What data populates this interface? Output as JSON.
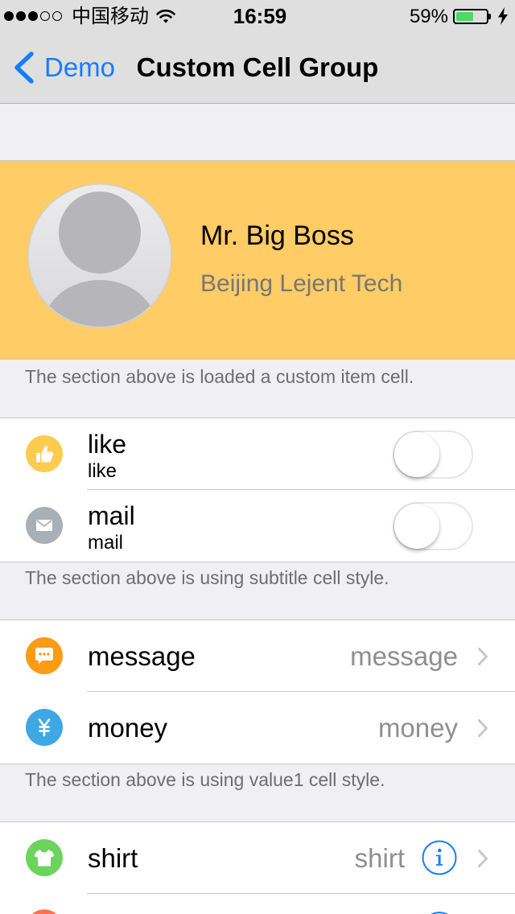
{
  "status_bar": {
    "signal_level": 3,
    "signal_max": 5,
    "carrier": "中国移动",
    "wifi_icon": "wifi-icon",
    "time": "16:59",
    "battery_text": "59%",
    "battery_level": 0.59,
    "battery_color": "#4cd964",
    "charging": true
  },
  "nav": {
    "back_icon": "chevron-left-icon",
    "back_label": "Demo",
    "title": "Custom Cell Group",
    "tint": "#157efb"
  },
  "profile": {
    "avatar_icon": "default-avatar-icon",
    "name": "Mr. Big Boss",
    "company": "Beijing Lejent Tech",
    "background": "#ffcc66"
  },
  "sections": [
    {
      "footer": "The section above is loaded a custom item cell."
    },
    {
      "rows": [
        {
          "icon": "thumbs-up-icon",
          "icon_color": "#fdcb4e",
          "title": "like",
          "subtitle": "like",
          "switch_on": false
        },
        {
          "icon": "mail-icon",
          "icon_color": "#a9afb6",
          "title": "mail",
          "subtitle": "mail",
          "switch_on": false
        }
      ],
      "footer": "The section above is using subtitle cell style."
    },
    {
      "rows": [
        {
          "icon": "message-icon",
          "icon_color": "#fb9c14",
          "title": "message",
          "detail": "message",
          "accessory": "chevron-right-icon"
        },
        {
          "icon": "yen-icon",
          "icon_color": "#3ea8e5",
          "title": "money",
          "detail": "money",
          "accessory": "chevron-right-icon"
        }
      ],
      "footer": "The section above is using value1 cell style."
    },
    {
      "rows": [
        {
          "icon": "shirt-icon",
          "icon_color": "#6cd45c",
          "title": "shirt",
          "detail": "shirt",
          "accessory": "info-icon, chevron-right-icon"
        },
        {
          "icon": "circle-icon",
          "icon_color": "#ff6f50",
          "accessory": "info-icon"
        }
      ]
    }
  ]
}
